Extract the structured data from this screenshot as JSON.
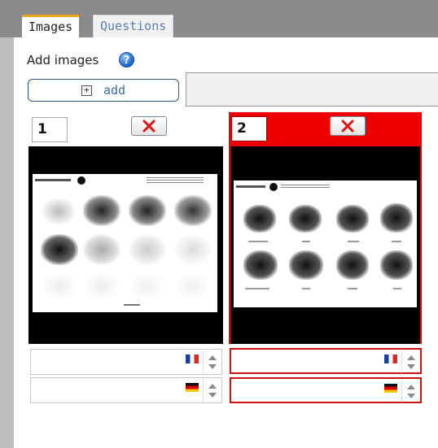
{
  "tabs": [
    {
      "label": "Images",
      "active": true
    },
    {
      "label": "Questions",
      "active": false
    }
  ],
  "add_images": {
    "title": "Add images",
    "button_label": "add",
    "file_value": ""
  },
  "images": [
    {
      "number": "1",
      "selected": false,
      "fields": [
        {
          "flag": "fr",
          "value": ""
        },
        {
          "flag": "de",
          "value": ""
        }
      ]
    },
    {
      "number": "2",
      "selected": true,
      "fields": [
        {
          "flag": "fr",
          "value": ""
        },
        {
          "flag": "de",
          "value": ""
        }
      ]
    }
  ],
  "colors": {
    "accent_tab": "#f0a020",
    "selected_border": "#ee0000",
    "link_blue": "#3a6aa5"
  },
  "icons": [
    "help-icon",
    "plus-icon",
    "delete-x-icon",
    "flag-france-icon",
    "flag-germany-icon",
    "spinner-up-icon",
    "spinner-down-icon"
  ]
}
